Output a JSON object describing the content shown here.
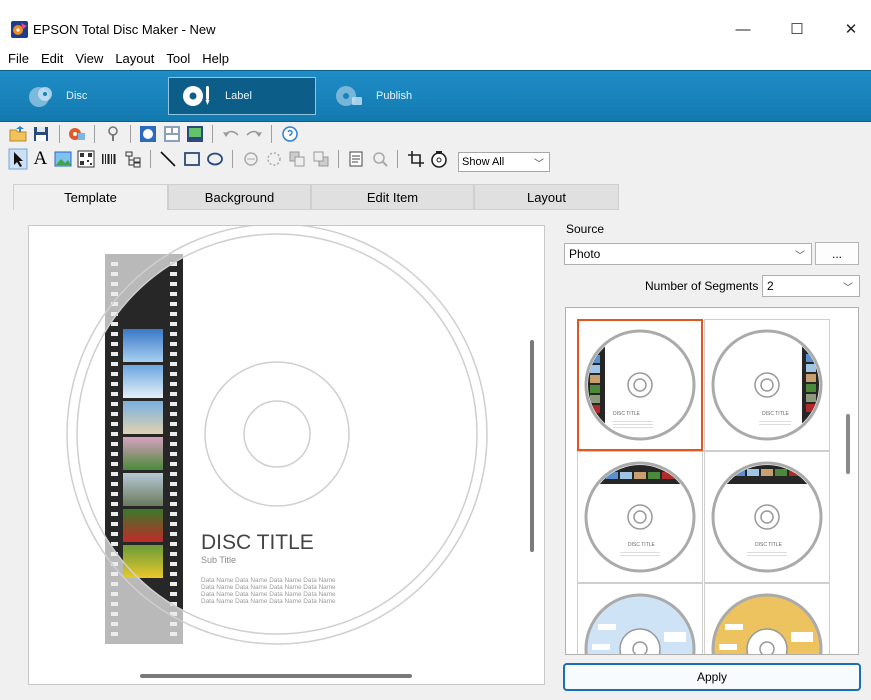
{
  "window": {
    "title": "EPSON Total Disc Maker - New",
    "minimize_glyph": "—",
    "maximize_glyph": "☐",
    "close_glyph": "✕"
  },
  "menu": [
    "File",
    "Edit",
    "View",
    "Layout",
    "Tool",
    "Help"
  ],
  "modes": [
    {
      "label": "Disc",
      "icon": "disc-icon"
    },
    {
      "label": "Label",
      "icon": "label-icon"
    },
    {
      "label": "Publish",
      "icon": "publish-icon"
    }
  ],
  "toolbar2": {
    "text_tool_glyph": "A",
    "show_all": "Show All"
  },
  "tabs": [
    "Template",
    "Background",
    "Edit Item",
    "Layout"
  ],
  "canvas": {
    "disc_title": "DISC TITLE",
    "sub_title": "Sub Title",
    "data_lines": [
      "Data Name Data Name Data Name Data Name",
      "Data Name Data Name Data Name Data Name",
      "Data Name Data Name Data Name Data Name",
      "Data Name Data Name Data Name Data Name"
    ]
  },
  "source": {
    "label": "Source",
    "value": "Photo",
    "browse": "..."
  },
  "segments": {
    "label": "Number of Segments",
    "value": "2"
  },
  "templates": {
    "mini_title": "DISC TITLE"
  },
  "apply_label": "Apply",
  "colors": {
    "mode_bar": "#1782bc",
    "selected_template": "#e2571b",
    "apply_border": "#1b6db5"
  }
}
